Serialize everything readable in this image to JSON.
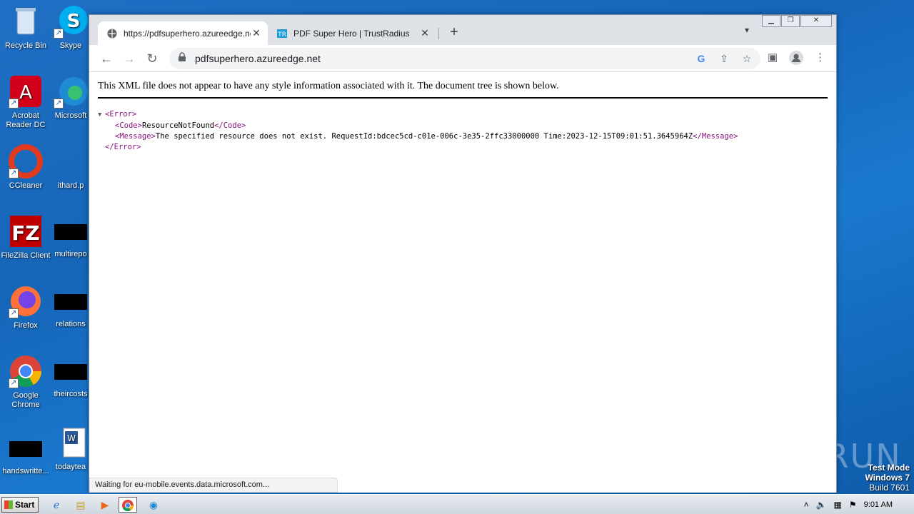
{
  "desktop": {
    "icons": [
      {
        "label": "Recycle Bin"
      },
      {
        "label": "Skype"
      },
      {
        "label": "Acrobat Reader DC"
      },
      {
        "label": "Microsoft"
      },
      {
        "label": "CCleaner"
      },
      {
        "label": "ithard.p"
      },
      {
        "label": "FileZilla Client"
      },
      {
        "label": "multirepo"
      },
      {
        "label": "Firefox"
      },
      {
        "label": "relations"
      },
      {
        "label": "Google Chrome"
      },
      {
        "label": "theircosts"
      },
      {
        "label": "handswritte..."
      },
      {
        "label": "todaytea"
      }
    ],
    "watermark": "ANY RUN",
    "testmode": {
      "line1": "Test Mode",
      "line2": "Windows 7",
      "line3": "Build 7601"
    }
  },
  "browser": {
    "tabs": [
      {
        "title": "https://pdfsuperhero.azureedge.net",
        "active": true
      },
      {
        "title": "PDF Super Hero | TrustRadius",
        "active": false
      }
    ],
    "new_tab_label": "+",
    "address": "pdfsuperhero.azureedge.net",
    "xml_header": "This XML file does not appear to have any style information associated with it. The document tree is shown below.",
    "xml": {
      "error_open": "<Error>",
      "code_open": "<Code>",
      "code_value": "ResourceNotFound",
      "code_close": "</Code>",
      "message_open": "<Message>",
      "message_value": "The specified resource does not exist. RequestId:bdcec5cd-c01e-006c-3e35-2ffc33000000 Time:2023-12-15T09:01:51.3645964Z",
      "message_close": "</Message>",
      "error_close": "</Error>"
    },
    "status_text": "Waiting for eu-mobile.events.data.microsoft.com..."
  },
  "taskbar": {
    "start_label": "Start",
    "clock": "9:01 AM"
  }
}
